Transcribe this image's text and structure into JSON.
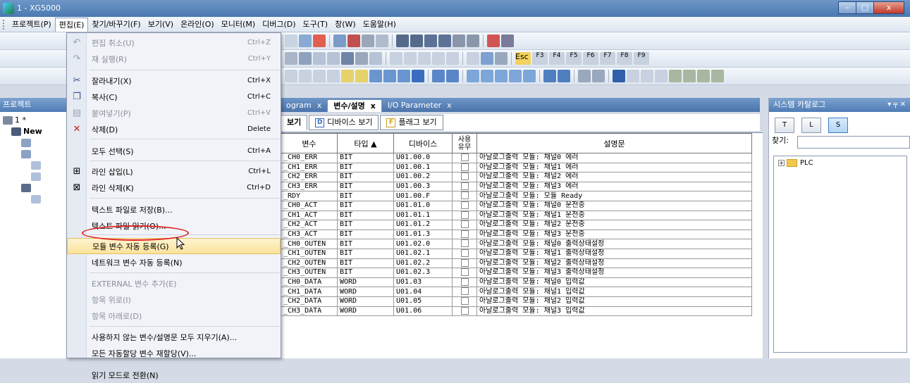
{
  "window": {
    "title": "1 - XG5000",
    "buttons": [
      "–",
      "□",
      "x"
    ]
  },
  "menubar": [
    "프로젝트(P)",
    "편집(E)",
    "찾기/바꾸기(F)",
    "보기(V)",
    "온라인(O)",
    "모니터(M)",
    "디버그(D)",
    "도구(T)",
    "창(W)",
    "도움말(H)"
  ],
  "project_panel": {
    "title": "프로젝트",
    "tree": [
      "1 *",
      "New",
      "",
      "",
      "",
      ""
    ]
  },
  "tabs": [
    {
      "label": "ogram",
      "close": "x"
    },
    {
      "label": "변수/설명",
      "close": "x"
    },
    {
      "label": "I/O Parameter",
      "close": "x"
    }
  ],
  "toolbar_keys": [
    "Esc",
    "F3",
    "F4",
    "F5",
    "F6",
    "F7",
    "F8",
    "F9"
  ],
  "view_buttons": [
    "보기",
    "디바이스 보기",
    "플래그 보기"
  ],
  "table": {
    "headers": [
      "변수",
      "타입",
      "디바이스",
      "사용 유무",
      "설명문"
    ],
    "sort_indicator": "▲",
    "rows": [
      [
        "_CH0_ERR",
        "BIT",
        "U01.00.0",
        "아날로그출력 모듈: 채널0 에러"
      ],
      [
        "_CH1_ERR",
        "BIT",
        "U01.00.1",
        "아날로그출력 모듈: 채널1 에러"
      ],
      [
        "_CH2_ERR",
        "BIT",
        "U01.00.2",
        "아날로그출력 모듈: 채널2 에러"
      ],
      [
        "_CH3_ERR",
        "BIT",
        "U01.00.3",
        "아날로그출력 모듈: 채널3 에러"
      ],
      [
        "_RDY",
        "BIT",
        "U01.00.F",
        "아날로그출력 모듈: 모듈 Ready"
      ],
      [
        "_CH0_ACT",
        "BIT",
        "U01.01.0",
        "아날로그출력 모듈: 채널0 운전중"
      ],
      [
        "_CH1_ACT",
        "BIT",
        "U01.01.1",
        "아날로그출력 모듈: 채널1 운전중"
      ],
      [
        "_CH2_ACT",
        "BIT",
        "U01.01.2",
        "아날로그출력 모듈: 채널2 운전중"
      ],
      [
        "_CH3_ACT",
        "BIT",
        "U01.01.3",
        "아날로그출력 모듈: 채널3 운전중"
      ],
      [
        "_CH0_OUTEN",
        "BIT",
        "U01.02.0",
        "아날로그출력 모듈: 채널0 출력상태설정"
      ],
      [
        "_CH1_OUTEN",
        "BIT",
        "U01.02.1",
        "아날로그출력 모듈: 채널1 출력상태설정"
      ],
      [
        "_CH2_OUTEN",
        "BIT",
        "U01.02.2",
        "아날로그출력 모듈: 채널2 출력상태설정"
      ],
      [
        "_CH3_OUTEN",
        "BIT",
        "U01.02.3",
        "아날로그출력 모듈: 채널3 출력상태설정"
      ],
      [
        "_CH0_DATA",
        "WORD",
        "U01.03",
        "아날로그출력 모듈: 채널0 입력값"
      ],
      [
        "_CH1_DATA",
        "WORD",
        "U01.04",
        "아날로그출력 모듈: 채널1 입력값"
      ],
      [
        "_CH2_DATA",
        "WORD",
        "U01.05",
        "아날로그출력 모듈: 채널2 입력값"
      ],
      [
        "_CH3_DATA",
        "WORD",
        "U01.06",
        "아날로그출력 모듈: 채널3 입력값"
      ]
    ]
  },
  "catalog": {
    "title": "시스템 카탈로그",
    "controls": "▾ ╤ ✕",
    "tabs": [
      "T",
      "L",
      "S"
    ],
    "search_label": "찾기:",
    "tree_root": "PLC"
  },
  "edit_menu": [
    {
      "label": "편집 취소(U)",
      "shortcut": "Ctrl+Z",
      "disabled": true,
      "icon": "undo-icon",
      "glyph": "↶"
    },
    {
      "label": "재 실행(R)",
      "shortcut": "Ctrl+Y",
      "disabled": true,
      "icon": "redo-icon",
      "glyph": "↷"
    },
    {
      "label": "잘라내기(X)",
      "shortcut": "Ctrl+X",
      "disabled": false,
      "icon": "cut-icon",
      "glyph": "✂"
    },
    {
      "label": "복사(C)",
      "shortcut": "Ctrl+C",
      "disabled": false,
      "icon": "copy-icon",
      "glyph": "❐"
    },
    {
      "label": "붙여넣기(P)",
      "shortcut": "Ctrl+V",
      "disabled": true,
      "icon": "paste-icon",
      "glyph": "▤"
    },
    {
      "label": "삭제(D)",
      "shortcut": "Delete",
      "disabled": false,
      "icon": "delete-icon",
      "glyph": "✕"
    },
    {
      "label": "모두 선택(S)",
      "shortcut": "Ctrl+A",
      "disabled": false
    },
    {
      "label": "라인 삽입(L)",
      "shortcut": "Ctrl+L",
      "disabled": false,
      "icon": "insert-line-icon",
      "glyph": "⊞"
    },
    {
      "label": "라인 삭제(K)",
      "shortcut": "Ctrl+D",
      "disabled": false,
      "icon": "delete-line-icon",
      "glyph": "⊠"
    },
    {
      "label": "텍스트 파일로 저장(B)...",
      "shortcut": "",
      "disabled": false
    },
    {
      "label": "텍스트 파일 읽기(O)...",
      "shortcut": "",
      "disabled": false
    },
    {
      "label": "모듈 변수 자동 등록(G)",
      "shortcut": "",
      "disabled": false,
      "highlighted": true
    },
    {
      "label": "네트워크 변수 자동 등록(N)",
      "shortcut": "",
      "disabled": false
    },
    {
      "label": "EXTERNAL 변수 추가(E)",
      "shortcut": "",
      "disabled": true
    },
    {
      "label": "항목 위로(I)",
      "shortcut": "",
      "disabled": true
    },
    {
      "label": "항목 아래로(D)",
      "shortcut": "",
      "disabled": true
    },
    {
      "label": "사용하지 않는 변수/설명문 모두 지우기(A)...",
      "shortcut": "",
      "disabled": false
    },
    {
      "label": "모든 자동할당 변수 재할당(V)...",
      "shortcut": "",
      "disabled": false
    },
    {
      "label": "읽기 모드로 전환(N)",
      "shortcut": "",
      "disabled": false
    }
  ]
}
